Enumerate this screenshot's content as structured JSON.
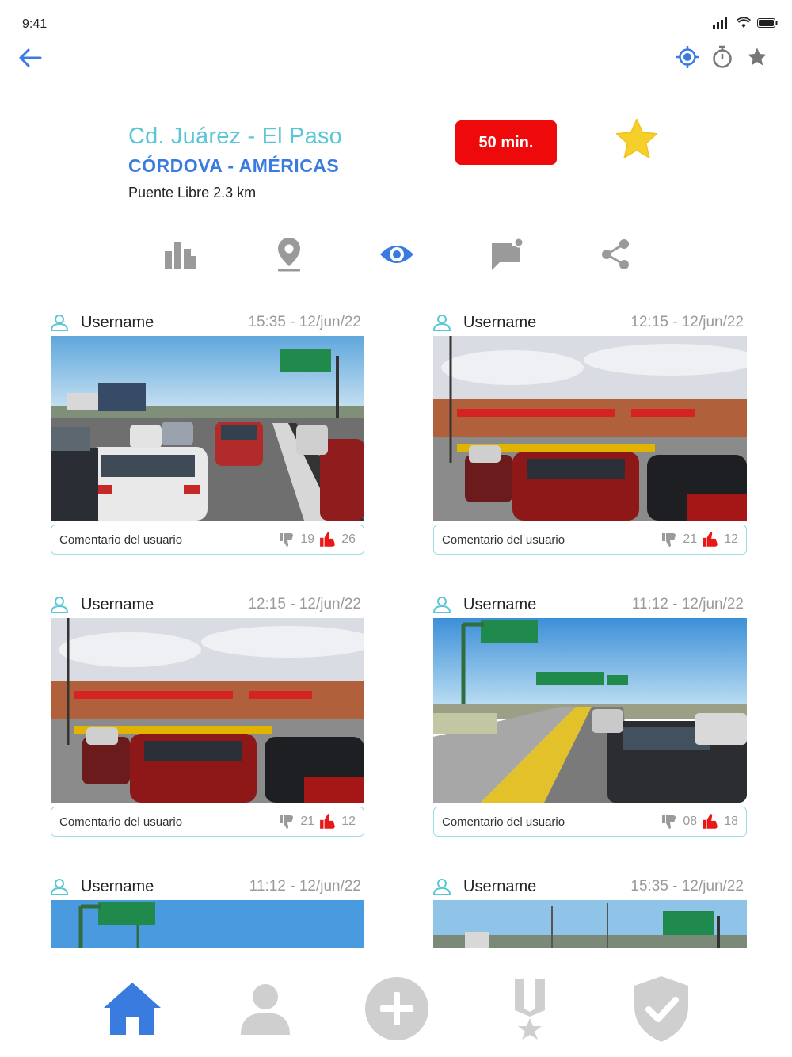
{
  "status_bar": {
    "time": "9:41"
  },
  "header": {
    "city": "Cd. Juárez  - El Paso",
    "crossing": "CÓRDOVA - AMÉRICAS",
    "subtitle": "Puente Libre 2.3 km",
    "wait_time": "50 min."
  },
  "colors": {
    "accent_blue": "#3a7be0",
    "city_teal": "#5bc6d6",
    "badge_red": "#ee0a0a",
    "star_yellow": "#f7cf2b",
    "like_red": "#e81818",
    "inactive_gray": "#cfcfcf"
  },
  "tabs": [
    {
      "name": "stats",
      "icon": "bar-chart-icon",
      "active": false
    },
    {
      "name": "location",
      "icon": "map-pin-icon",
      "active": false
    },
    {
      "name": "views",
      "icon": "eye-icon",
      "active": true
    },
    {
      "name": "comments",
      "icon": "comment-icon",
      "active": false
    },
    {
      "name": "share",
      "icon": "share-icon",
      "active": false
    }
  ],
  "posts": [
    {
      "username": "Username",
      "time": "15:35 -  12/jun/22",
      "comment": "Comentario del usuario",
      "dislikes": "19",
      "likes": "26",
      "photo": "traffic-line"
    },
    {
      "username": "Username",
      "time": "12:15 -  12/jun/22",
      "comment": "Comentario del usuario",
      "dislikes": "21",
      "likes": "12",
      "photo": "border-booths"
    },
    {
      "username": "Username",
      "time": "12:15 -  12/jun/22",
      "comment": "Comentario del usuario",
      "dislikes": "21",
      "likes": "12",
      "photo": "border-booths"
    },
    {
      "username": "Username",
      "time": "11:12 -  12/jun/22",
      "comment": "Comentario del usuario",
      "dislikes": "08",
      "likes": "18",
      "photo": "highway-queue"
    },
    {
      "username": "Username",
      "time": "11:12 -  12/jun/22",
      "photo": "highway-queue"
    },
    {
      "username": "Username",
      "time": "15:35 -  12/jun/22",
      "photo": "traffic-line"
    }
  ],
  "bottom_nav": [
    {
      "name": "home",
      "icon": "home-icon",
      "active": true
    },
    {
      "name": "profile",
      "icon": "person-icon",
      "active": false
    },
    {
      "name": "add",
      "icon": "plus-circle-icon",
      "active": false
    },
    {
      "name": "rewards",
      "icon": "medal-icon",
      "active": false
    },
    {
      "name": "security",
      "icon": "shield-check-icon",
      "active": false
    }
  ]
}
